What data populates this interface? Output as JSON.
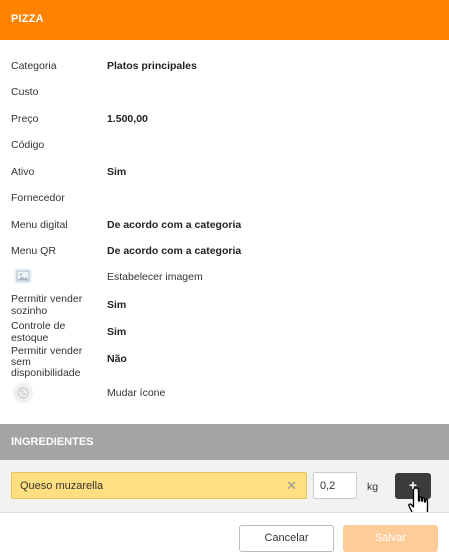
{
  "header": {
    "title": "PIZZA",
    "color": "#ff8200"
  },
  "fields": {
    "categoria": {
      "label": "Categoria",
      "value": "Platos principales"
    },
    "custo": {
      "label": "Custo",
      "value": ""
    },
    "preco": {
      "label": "Preço",
      "value": "1.500,00"
    },
    "codigo": {
      "label": "Código",
      "value": ""
    },
    "ativo": {
      "label": "Ativo",
      "value": "Sim"
    },
    "fornecedor": {
      "label": "Fornecedor",
      "value": ""
    },
    "menu_digital": {
      "label": "Menu digital",
      "value": "De acordo com a categoria"
    },
    "menu_qr": {
      "label": "Menu QR",
      "value": "De acordo com a categoria"
    },
    "imagem": {
      "icon": "image-icon",
      "value": "Estabelecer imagem"
    },
    "vender_sozinho": {
      "label_line1": "Permitir vender",
      "label_line2": "sozinho",
      "value": "Sim"
    },
    "controle_estoque": {
      "label_line1": "Controle de",
      "label_line2": "estoque",
      "value": "Sim"
    },
    "vender_sem_disp": {
      "label_line1": "Permitir vender",
      "label_line2": "sem",
      "label_line3": "disponibilidade",
      "value": "Não"
    },
    "icone": {
      "icon": "pizza-icon",
      "value": "Mudar ícone"
    }
  },
  "ingredients": {
    "title": "INGREDIENTES",
    "input_value": "Queso muzarella",
    "clear_icon": "close-icon",
    "quantity": "0,2",
    "unit": "kg",
    "add_label": "+"
  },
  "footer": {
    "cancel_label": "Cancelar",
    "save_label": "Salvar"
  }
}
